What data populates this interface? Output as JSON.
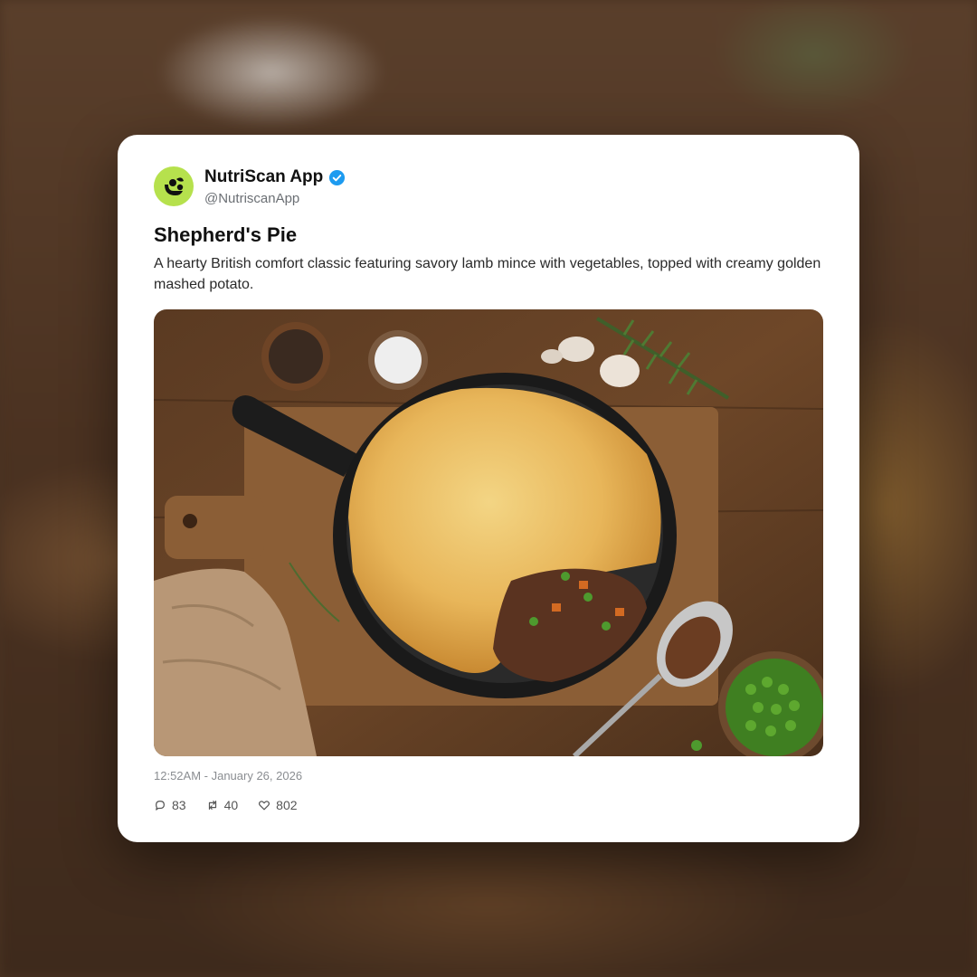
{
  "post": {
    "author_name": "NutriScan App",
    "author_handle": "@NutriscanApp",
    "verified_icon": "verified-badge-icon",
    "title": "Shepherd's Pie",
    "description": "A hearty British comfort classic featuring savory lamb mince with vegetables, topped with creamy golden mashed potato.",
    "timestamp": "12:52AM - January 26, 2026",
    "stats": {
      "replies": "83",
      "reposts": "40",
      "likes": "802"
    }
  },
  "colors": {
    "avatar_bg": "#b6e14d",
    "verified": "#1d9bf0"
  }
}
